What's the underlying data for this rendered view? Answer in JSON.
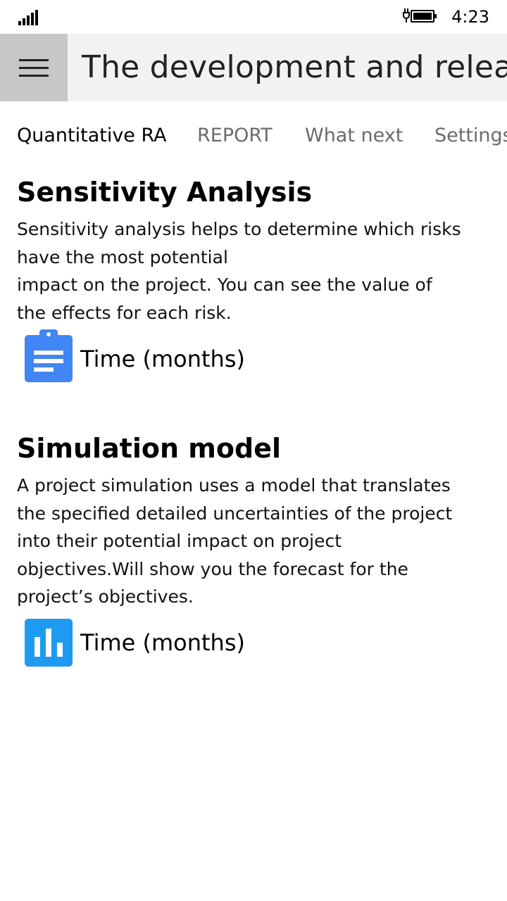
{
  "status_bar": {
    "time": "4:23"
  },
  "header": {
    "title": "The development and release"
  },
  "tabs": [
    {
      "label": "Quantitative RA"
    },
    {
      "label": "REPORT"
    },
    {
      "label": "What next"
    },
    {
      "label": "Settings"
    }
  ],
  "sections": [
    {
      "title": "Sensitivity Analysis",
      "description_lines": [
        "Sensitivity analysis helps to determine which risks",
        "have the most potential",
        "impact on the project. You can see the value of",
        "the effects for each risk."
      ],
      "action_label": "Time (months)",
      "icon": "clipboard-icon",
      "icon_color": "#4285f4"
    },
    {
      "title": "Simulation model",
      "description_lines": [
        "A project simulation uses a model that translates",
        "the specified detailed uncertainties of the project",
        "into their potential impact on project",
        "objectives.Will show you the forecast for the",
        "project’s objectives."
      ],
      "action_label": "Time (months)",
      "icon": "bar-chart-icon",
      "icon_color": "#1e9bf0"
    }
  ]
}
